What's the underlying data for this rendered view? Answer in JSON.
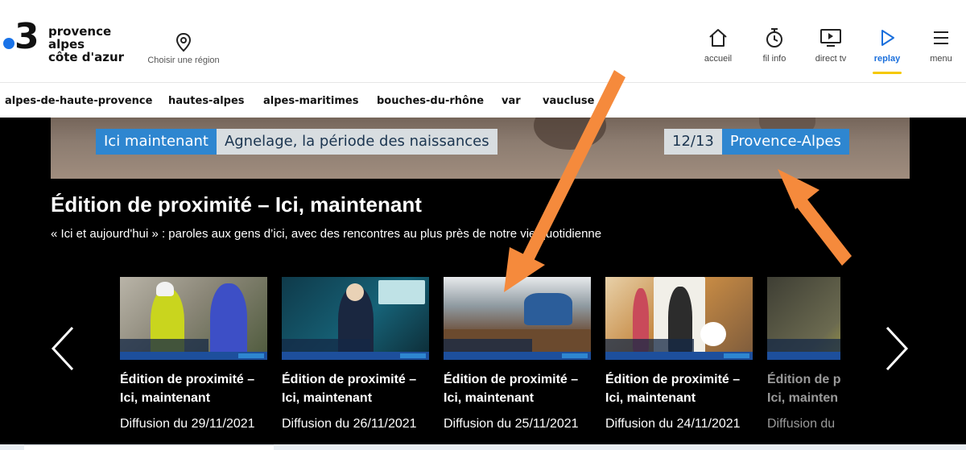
{
  "brand": {
    "number": "3",
    "lines": [
      "provence",
      "alpes",
      "côte d'azur"
    ],
    "dot_color": "#1a73e8"
  },
  "region_selector": {
    "label": "Choisir une région",
    "icon": "location-pin-icon"
  },
  "nav": [
    {
      "label": "accueil",
      "icon": "home-icon",
      "active": false
    },
    {
      "label": "fil info",
      "icon": "stopwatch-icon",
      "active": false
    },
    {
      "label": "direct tv",
      "icon": "tv-icon",
      "active": false
    },
    {
      "label": "replay",
      "icon": "play-icon",
      "active": true
    },
    {
      "label": "menu",
      "icon": "hamburger-icon",
      "active": false
    }
  ],
  "departments": [
    "alpes-de-haute-provence",
    "hautes-alpes",
    "alpes-maritimes",
    "bouches-du-rhône",
    "var",
    "vaucluse"
  ],
  "banner": {
    "tag": "Ici maintenant",
    "headline": "Agnelage, la période des naissances",
    "edition": "12/13",
    "region": "Provence-Alpes"
  },
  "program": {
    "title": "Édition de proximité – Ici, maintenant",
    "description": "« Ici et aujourd'hui » : paroles aux gens d’ici, avec des rencontres au plus près de notre vie quotidienne"
  },
  "episodes": [
    {
      "title_line1": "Édition de proximité –",
      "title_line2": "Ici, maintenant",
      "date": "Diffusion du 29/11/2021"
    },
    {
      "title_line1": "Édition de proximité –",
      "title_line2": "Ici, maintenant",
      "date": "Diffusion du 26/11/2021"
    },
    {
      "title_line1": "Édition de proximité –",
      "title_line2": "Ici, maintenant",
      "date": "Diffusion du 25/11/2021"
    },
    {
      "title_line1": "Édition de proximité –",
      "title_line2": "Ici, maintenant",
      "date": "Diffusion du 24/11/2021"
    },
    {
      "title_line1": "Édition de p",
      "title_line2": "Ici, mainten",
      "date": "Diffusion du"
    }
  ],
  "colors": {
    "accent_blue": "#1a6fdc",
    "replay_underline": "#f5c800",
    "annotation_arrow": "#f58a3c",
    "background_dark": "#000000"
  }
}
